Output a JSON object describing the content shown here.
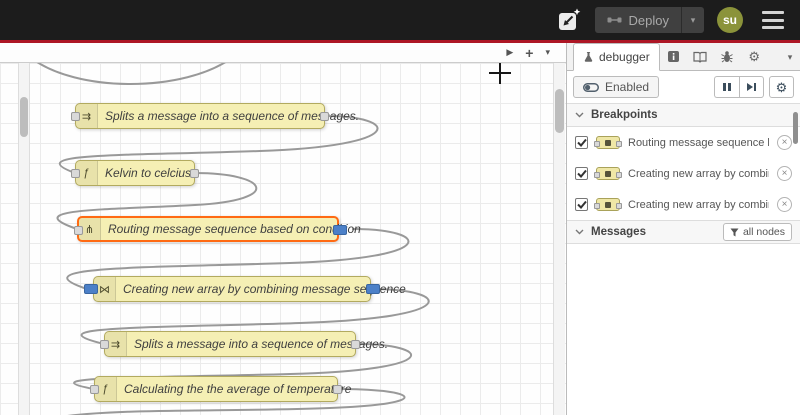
{
  "colors": {
    "header_bg": "#1c1c1c",
    "header_red": "#ad1625",
    "node_fill": "#f5efb4",
    "node_border": "#b2aa5f",
    "highlight_orange": "#ff6a13",
    "paused_blue": "#4c80c8",
    "avatar_bg": "#8b933a",
    "wire_gray": "#999999"
  },
  "icons": {
    "close": "×",
    "chevron_down": "▾",
    "plus": "+",
    "play": "▶",
    "gear": "⚙"
  },
  "header": {
    "deploy": {
      "label": "Deploy"
    },
    "avatar": {
      "text": "su"
    }
  },
  "canvas": {
    "nodes": [
      {
        "label": "Splits a message into a sequence of messages.",
        "icon": "split-icon",
        "glyph": "⇉"
      },
      {
        "label": "Kelvin to celcius",
        "icon": "function-icon",
        "glyph": "ƒ"
      },
      {
        "label": "Routing message sequence based on condition",
        "icon": "switch-icon",
        "glyph": "⋔"
      },
      {
        "label": "Creating new array by combining message sequence",
        "icon": "join-icon",
        "glyph": "⋈"
      },
      {
        "label": "Splits a message into a sequence of messages.",
        "icon": "split-icon",
        "glyph": "⇉"
      },
      {
        "label": "Calculating the the average of temperature",
        "icon": "function-icon",
        "glyph": "ƒ"
      }
    ]
  },
  "sidebar": {
    "tab": {
      "label": "debugger"
    },
    "toolbar": {
      "enabled_label": "Enabled"
    },
    "breakpoints_section": {
      "title": "Breakpoints"
    },
    "breakpoints": [
      {
        "label": "Routing message sequence ba"
      },
      {
        "label": "Creating new array by combini"
      },
      {
        "label": "Creating new array by combini"
      }
    ],
    "messages_section": {
      "title": "Messages",
      "filter_label": "all nodes"
    }
  }
}
